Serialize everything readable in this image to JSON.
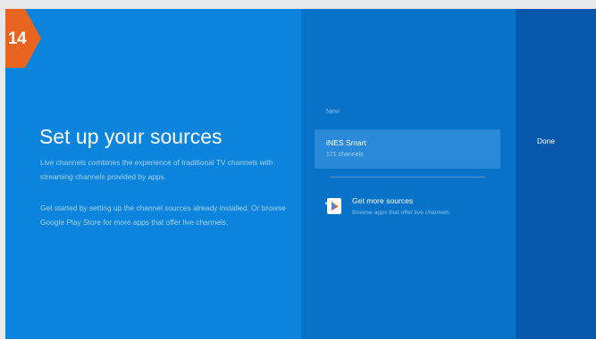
{
  "badge": {
    "number": "14",
    "color": "#e8641f"
  },
  "setup": {
    "title": "Set up your sources",
    "description_1": "Live channels combines the experience of traditional TV channels with streaming channels provided by apps.",
    "description_2": "Get started by setting up the channel sources already installed. Or browse Google Play Store for more apps that offer live channels."
  },
  "sources": {
    "section_label": "New",
    "items": [
      {
        "name": "iNES Smart",
        "channels": "171 channels"
      }
    ],
    "get_more": {
      "title": "Get more sources",
      "subtitle": "Browse apps that offer live channels",
      "icon": "google-play-icon"
    }
  },
  "actions": {
    "done_label": "Done"
  },
  "colors": {
    "left_panel": "#0a84dc",
    "middle_panel": "#0673c8",
    "right_panel": "#0558ab",
    "selected_card": "#2a8ad9"
  }
}
